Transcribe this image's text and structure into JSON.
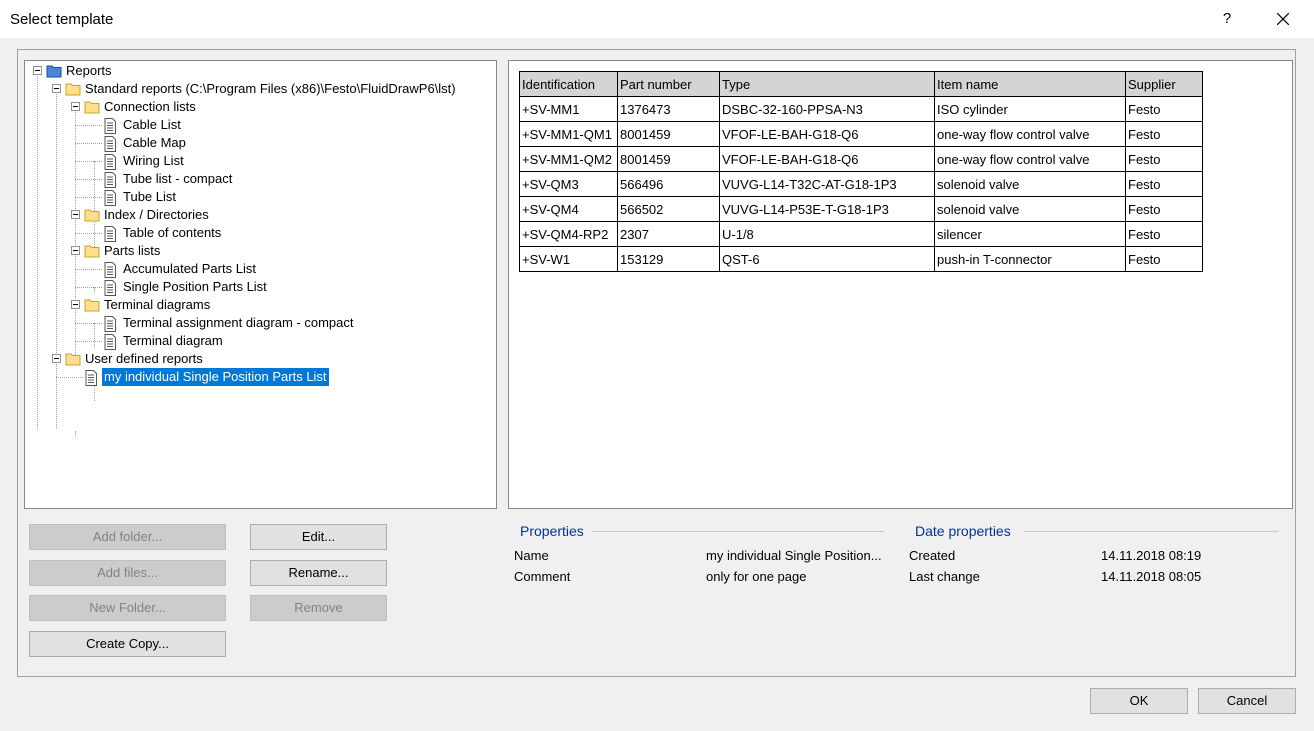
{
  "window": {
    "title": "Select template",
    "help_label": "?"
  },
  "tree": [
    {
      "label": "Reports",
      "level": 0,
      "icon": "folder-blue-icon",
      "expanded": true
    },
    {
      "label": "Standard reports (C:\\Program Files (x86)\\Festo\\FluidDrawP6\\lst)",
      "level": 1,
      "icon": "folder-icon",
      "expanded": true
    },
    {
      "label": "Connection lists",
      "level": 2,
      "icon": "folder-open-icon",
      "expanded": true
    },
    {
      "label": "Cable List",
      "level": 3,
      "icon": "document-icon"
    },
    {
      "label": "Cable Map",
      "level": 3,
      "icon": "document-icon"
    },
    {
      "label": "Wiring List",
      "level": 3,
      "icon": "document-icon"
    },
    {
      "label": "Tube list - compact",
      "level": 3,
      "icon": "document-icon"
    },
    {
      "label": "Tube List",
      "level": 3,
      "icon": "document-icon"
    },
    {
      "label": "Index / Directories",
      "level": 2,
      "icon": "folder-open-icon",
      "expanded": true
    },
    {
      "label": "Table of contents",
      "level": 3,
      "icon": "document-icon"
    },
    {
      "label": "Parts lists",
      "level": 2,
      "icon": "folder-open-icon",
      "expanded": true
    },
    {
      "label": "Accumulated Parts List",
      "level": 3,
      "icon": "document-icon"
    },
    {
      "label": "Single Position Parts List",
      "level": 3,
      "icon": "document-icon"
    },
    {
      "label": "Terminal diagrams",
      "level": 2,
      "icon": "folder-open-icon",
      "expanded": true
    },
    {
      "label": "Terminal assignment diagram - compact",
      "level": 3,
      "icon": "document-icon"
    },
    {
      "label": "Terminal diagram",
      "level": 3,
      "icon": "document-icon"
    },
    {
      "label": "User defined reports",
      "level": 1,
      "icon": "folder-icon",
      "expanded": true
    },
    {
      "label": "my individual Single Position Parts List",
      "level": 2,
      "icon": "document-icon",
      "selected": true
    }
  ],
  "preview": {
    "columns": [
      "Identification",
      "Part number",
      "Type",
      "Item name",
      "Supplier"
    ],
    "rows": [
      [
        "+SV-MM1",
        "1376473",
        "DSBC-32-160-PPSA-N3",
        "ISO cylinder",
        "Festo"
      ],
      [
        "+SV-MM1-QM1",
        "8001459",
        "VFOF-LE-BAH-G18-Q6",
        "one-way flow control valve",
        "Festo"
      ],
      [
        "+SV-MM1-QM2",
        "8001459",
        "VFOF-LE-BAH-G18-Q6",
        "one-way flow control valve",
        "Festo"
      ],
      [
        "+SV-QM3",
        "566496",
        "VUVG-L14-T32C-AT-G18-1P3",
        "solenoid valve",
        "Festo"
      ],
      [
        "+SV-QM4",
        "566502",
        "VUVG-L14-P53E-T-G18-1P3",
        "solenoid valve",
        "Festo"
      ],
      [
        "+SV-QM4-RP2",
        "2307",
        "U-1/8",
        "silencer",
        "Festo"
      ],
      [
        "+SV-W1",
        "153129",
        "QST-6",
        "push-in T-connector",
        "Festo"
      ]
    ]
  },
  "buttons": {
    "add_folder": "Add folder...",
    "add_files": "Add files...",
    "new_folder": "New Folder...",
    "create_copy": "Create Copy...",
    "edit": "Edit...",
    "rename": "Rename...",
    "remove": "Remove",
    "ok": "OK",
    "cancel": "Cancel"
  },
  "properties": {
    "title": "Properties",
    "name_label": "Name",
    "name_value": "my individual Single Position...",
    "comment_label": "Comment",
    "comment_value": "only for one page"
  },
  "date_properties": {
    "title": "Date properties",
    "created_label": "Created",
    "created_value": "14.11.2018 08:19",
    "changed_label": "Last change",
    "changed_value": "14.11.2018 08:05"
  },
  "colors": {
    "selection": "#0078d7",
    "section_title": "#003399",
    "table_header": "#d4d4d4"
  }
}
